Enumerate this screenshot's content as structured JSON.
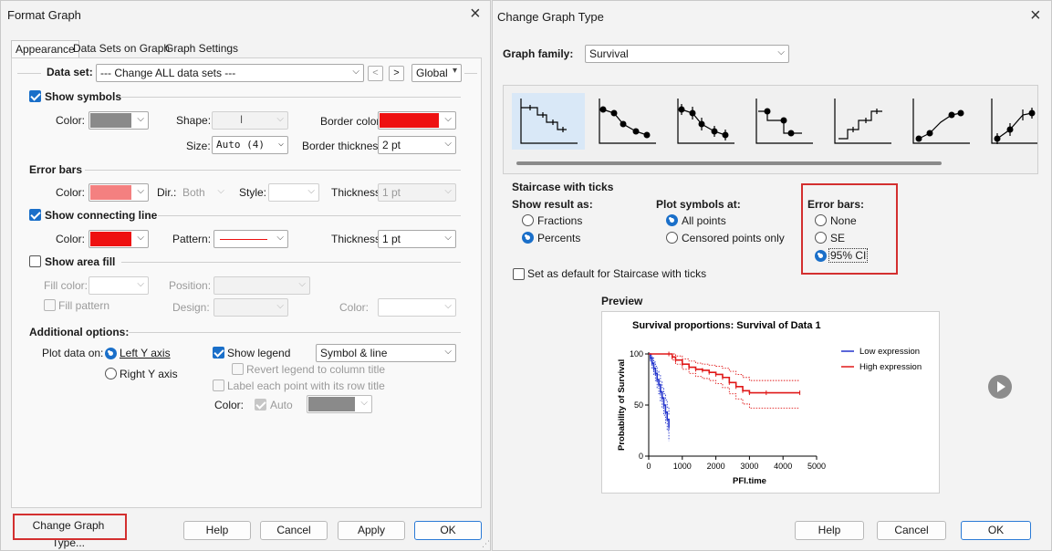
{
  "format_graph": {
    "title": "Format Graph",
    "tabs": [
      "Appearance",
      "Data Sets on Graph",
      "Graph Settings"
    ],
    "data_set_label": "Data set:",
    "data_set_value": "--- Change ALL data sets ---",
    "prev": "<",
    "next": ">",
    "global": "Global",
    "show_symbols": "Show symbols",
    "color_label": "Color:",
    "shape_label": "Shape:",
    "shape_value": "ǀ",
    "border_color_label": "Border color:",
    "size_label": "Size:",
    "size_value": "Auto (4)",
    "border_thickness_label": "Border thickness:",
    "border_thickness_value": "2 pt",
    "error_bars": "Error bars",
    "dir_label": "Dir.:",
    "dir_value": "Both",
    "style_label": "Style:",
    "thickness_label": "Thickness:",
    "eb_thickness_value": "1 pt",
    "show_connecting_line": "Show connecting line",
    "pattern_label": "Pattern:",
    "cl_thickness_value": "1 pt",
    "show_area_fill": "Show area fill",
    "fill_color_label": "Fill color:",
    "position_label": "Position:",
    "fill_pattern": "Fill pattern",
    "design_label": "Design:",
    "af_color_label": "Color:",
    "additional_options": "Additional options:",
    "plot_data_on": "Plot data on:",
    "left_y_axis": "Left Y axis",
    "right_y_axis": "Right  Y axis",
    "show_legend": "Show legend",
    "legend_value": "Symbol & line",
    "revert_legend": "Revert legend to column title",
    "label_each_point": "Label each point with its row title",
    "legend_color_label": "Color:",
    "auto": "Auto",
    "change_graph_type": "Change Graph Type...",
    "help": "Help",
    "cancel": "Cancel",
    "apply": "Apply",
    "ok": "OK"
  },
  "change_graph_type": {
    "title": "Change Graph Type",
    "graph_family_label": "Graph family:",
    "graph_family_value": "Survival",
    "selected_type": "Staircase with ticks",
    "show_result_as": "Show result as:",
    "fractions": "Fractions",
    "percents": "Percents",
    "plot_symbols_at": "Plot symbols at:",
    "all_points": "All points",
    "censored_only": "Censored points only",
    "error_bars": "Error bars:",
    "none": "None",
    "se": "SE",
    "ci95": "95% CI",
    "set_default": "Set as default for Staircase with ticks",
    "preview_label": "Preview",
    "help": "Help",
    "cancel": "Cancel",
    "ok": "OK"
  },
  "colors": {
    "symbol_color": "#8a8a8a",
    "border_color": "#ee1111",
    "error_bar_color": "#f48080",
    "line_color": "#ee1111",
    "legend_color": "#8a8a8a",
    "low_series": "#2233cc",
    "high_series": "#e01818"
  },
  "chart_data": {
    "type": "line",
    "title": "Survival proportions: Survival of Data 1",
    "xlabel": "PFI.time",
    "ylabel": "Probability of Survival",
    "xlim": [
      0,
      5000
    ],
    "ylim": [
      0,
      100
    ],
    "xticks": [
      0,
      1000,
      2000,
      3000,
      4000,
      5000
    ],
    "yticks": [
      0,
      50,
      100
    ],
    "legend_position": "top-right",
    "series": [
      {
        "name": "Low expression",
        "color": "#2233cc",
        "x": [
          0,
          50,
          100,
          150,
          200,
          250,
          300,
          350,
          400,
          450,
          500,
          550,
          600
        ],
        "y": [
          100,
          96,
          91,
          86,
          81,
          75,
          70,
          63,
          57,
          50,
          43,
          36,
          28
        ],
        "lower": [
          100,
          93,
          86,
          80,
          74,
          67,
          61,
          54,
          47,
          40,
          32,
          25,
          15
        ],
        "upper": [
          100,
          99,
          96,
          92,
          88,
          83,
          79,
          73,
          67,
          61,
          55,
          48,
          40
        ]
      },
      {
        "name": "High expression",
        "color": "#e01818",
        "x": [
          0,
          600,
          700,
          800,
          1000,
          1200,
          1400,
          1600,
          1800,
          2000,
          2200,
          2400,
          2600,
          2800,
          3000,
          3500,
          4500
        ],
        "y": [
          100,
          100,
          97,
          94,
          90,
          87,
          85,
          84,
          82,
          80,
          77,
          72,
          68,
          64,
          62,
          62,
          62
        ],
        "lower": [
          100,
          100,
          94,
          90,
          85,
          81,
          78,
          76,
          74,
          71,
          67,
          61,
          56,
          51,
          47,
          47,
          47
        ],
        "upper": [
          100,
          100,
          100,
          98,
          95,
          93,
          91,
          90,
          89,
          88,
          86,
          83,
          80,
          77,
          74,
          74,
          74
        ]
      }
    ]
  }
}
